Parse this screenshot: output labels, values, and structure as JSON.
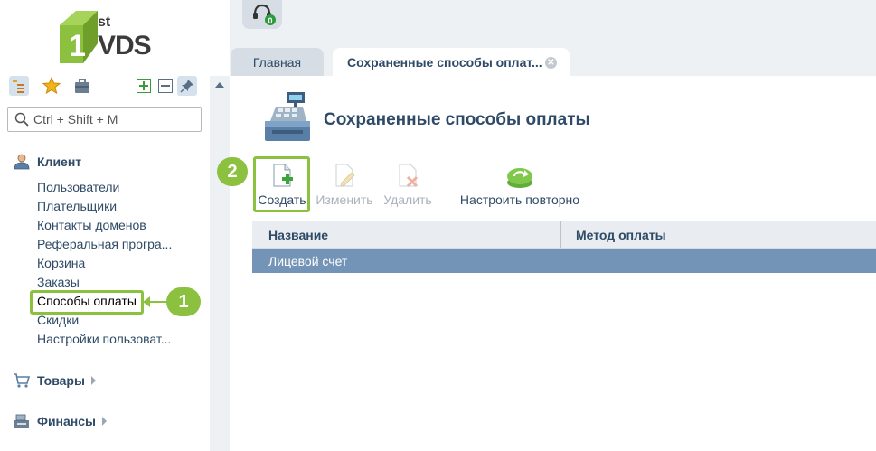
{
  "logo": {
    "superscript": "st",
    "brand": "VDS"
  },
  "sidebar": {
    "search_placeholder": "Ctrl + Shift + M",
    "groups": {
      "client": "Клиент",
      "goods": "Товары",
      "finance": "Финансы"
    },
    "items": [
      "Пользователи",
      "Плательщики",
      "Контакты доменов",
      "Реферальная програ...",
      "Корзина",
      "Заказы",
      "Способы оплаты",
      "Скидки",
      "Настройки пользоват..."
    ],
    "selected_item": "Способы оплаты"
  },
  "callouts": {
    "first": "1",
    "second": "2"
  },
  "tabs": {
    "main": "Главная",
    "active": "Сохраненные способы оплат..."
  },
  "page": {
    "title": "Сохраненные способы оплаты"
  },
  "toolbar": {
    "create": "Создать",
    "edit": "Изменить",
    "delete": "Удалить",
    "reconfigure": "Настроить повторно"
  },
  "table": {
    "columns": [
      "Название",
      "Метод оплаты"
    ],
    "rows": [
      {
        "name": "Лицевой счет",
        "method": ""
      }
    ]
  },
  "colors": {
    "accent_green": "#8cc13f",
    "text_blue": "#2e4a66",
    "row_selected": "#7394b6",
    "disabled_text": "#a9b2bc"
  }
}
